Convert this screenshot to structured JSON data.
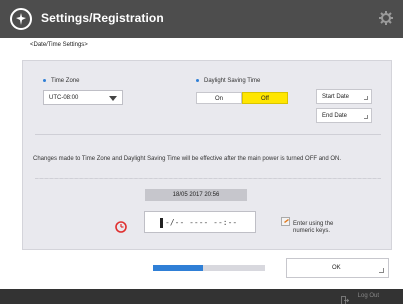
{
  "header": {
    "title": "Settings/Registration",
    "logo_icon": "settings-registration-icon",
    "gear_icon": "gear-icon"
  },
  "breadcrumb": "<Date/Time Settings>",
  "time_zone": {
    "label": "Time Zone",
    "value": "UTC-08:00"
  },
  "dst": {
    "label": "Daylight Saving Time",
    "on_label": "On",
    "off_label": "Off",
    "selected": "Off"
  },
  "buttons": {
    "start_date": "Start Date",
    "end_date": "End Date",
    "ok": "OK"
  },
  "notice": "Changes made to Time Zone and Daylight Saving Time will be effective after the main power is turned OFF and ON.",
  "current_datetime": "18/05 2017 20:56",
  "entry_field": {
    "mask": "-/-- ---- --:--"
  },
  "hint": "Enter using the numeric keys.",
  "progress": 0.45,
  "footer": {
    "logout_label": "Log Out"
  },
  "colors": {
    "header_bg": "#4d4d4d",
    "panel_bg": "#e9e9ee",
    "accent_blue": "#2f7fd6",
    "selected_yellow": "#ffe600",
    "alert_red": "#e03030"
  }
}
